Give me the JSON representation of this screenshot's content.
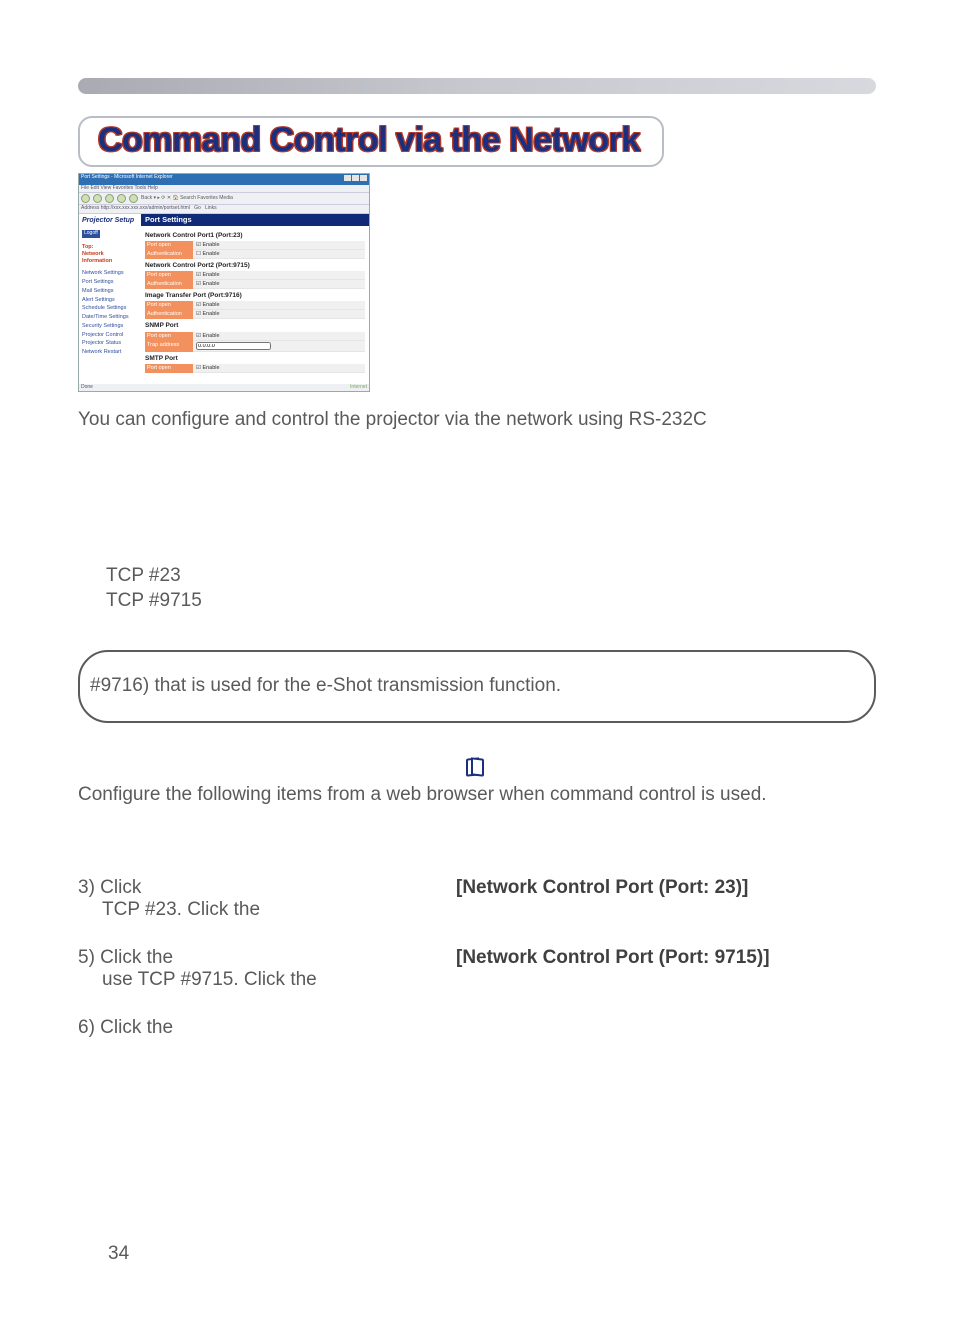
{
  "heading": "Command Control via the Network",
  "intro_paragraph": "You can configure and control the projector via the network using RS-232C",
  "ports": {
    "line1": "TCP #23",
    "line2": "TCP #9715"
  },
  "callout_text": "#9716) that is used for the e-Shot transmission function.",
  "configure_line": "Configure the following items from a web browser when command control is used.",
  "steps": {
    "s3_left": "3) Click",
    "s3_right": "[Network Control Port (Port: 23)]",
    "s3_tcp": "TCP #23. Click the",
    "s5_left": "5) Click the",
    "s5_right": "[Network Control Port (Port: 9715)]",
    "s5_tcp": "use TCP #9715. Click the",
    "s6_left": "6) Click the"
  },
  "page_number": "34",
  "screenshot": {
    "window_title": "Port Settings - Microsoft Internet Explorer",
    "menubar": "File   Edit   View   Favorites   Tools   Help",
    "toolbar_text": "Back  ▾  ▸   ⟳  ✕  🏠   Search   Favorites   Media",
    "address_label": "Address",
    "address_value": "http://xxx.xxx.xxx.xxx/admin/portset.html",
    "go_label": "Go",
    "links_label": "Links",
    "left_panel": {
      "setup_title": "Projector Setup",
      "logoff": "Logoff",
      "top": "Top:",
      "network": "Network",
      "information": "Information",
      "items": [
        "Network Settings",
        "Port Settings",
        "Mail Settings",
        "Alert Settings",
        "Schedule Settings",
        "Date/Time Settings",
        "Security Settings",
        "Projector Control",
        "Projector Status",
        "Network Restart"
      ]
    },
    "right_panel": {
      "header": "Port Settings",
      "sections": [
        {
          "title": "Network Control Port1 (Port:23)",
          "rows": [
            {
              "label": "Port open",
              "value": "☑ Enable"
            },
            {
              "label": "Authentication",
              "value": "☐ Enable"
            }
          ]
        },
        {
          "title": "Network Control Port2 (Port:9715)",
          "rows": [
            {
              "label": "Port open",
              "value": "☑ Enable"
            },
            {
              "label": "Authentication",
              "value": "☑ Enable"
            }
          ]
        },
        {
          "title": "Image Transfer Port (Port:9716)",
          "rows": [
            {
              "label": "Port open",
              "value": "☑ Enable"
            },
            {
              "label": "Authentication",
              "value": "☑ Enable"
            }
          ]
        },
        {
          "title": "SNMP Port",
          "rows": [
            {
              "label": "Port open",
              "value": "☑ Enable"
            },
            {
              "label": "Trap address",
              "value": "0.0.0.0",
              "input": true
            }
          ]
        },
        {
          "title": "SMTP Port",
          "rows": [
            {
              "label": "Port open",
              "value": "☑ Enable"
            }
          ]
        }
      ]
    },
    "status_left": "Done",
    "status_right": "Internet"
  }
}
